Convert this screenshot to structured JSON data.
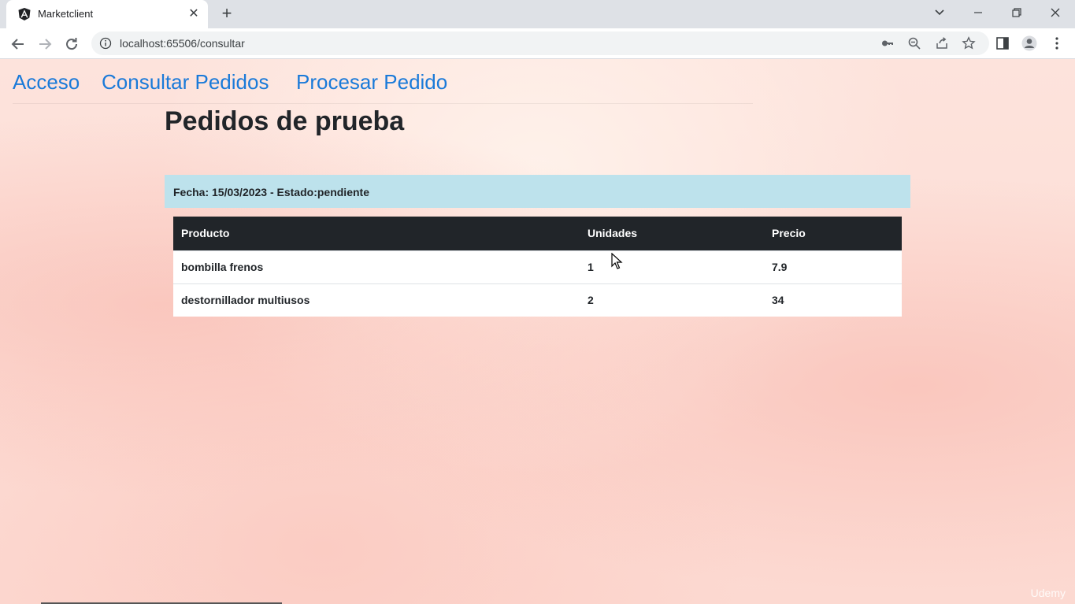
{
  "browser": {
    "tab_title": "Marketclient",
    "url": "localhost:65506/consultar"
  },
  "nav": {
    "links": [
      "Acceso",
      "Consultar Pedidos",
      "Procesar Pedido"
    ]
  },
  "page": {
    "title": "Pedidos de prueba"
  },
  "order": {
    "header": "Fecha: 15/03/2023 - Estado:pendiente",
    "columns": [
      "Producto",
      "Unidades",
      "Precio"
    ],
    "rows": [
      [
        "bombilla frenos",
        "1",
        "7.9"
      ],
      [
        "destornillador multiusos",
        "2",
        "34"
      ]
    ]
  },
  "watermark": "Udemy",
  "icons": {
    "favicon": "angular-icon",
    "tab_close": "close-icon",
    "new_tab": "plus-icon",
    "tab_search": "chevron-down-icon",
    "minimize": "minimize-icon",
    "restore": "restore-icon",
    "close_window": "close-icon",
    "back": "back-arrow-icon",
    "forward": "forward-arrow-icon",
    "reload": "reload-icon",
    "site_info": "info-icon",
    "password": "key-icon",
    "zoom": "zoom-out-icon",
    "share": "share-icon",
    "bookmark": "star-icon",
    "side_panel": "side-panel-icon",
    "profile": "profile-icon",
    "menu": "kebab-menu-icon"
  }
}
